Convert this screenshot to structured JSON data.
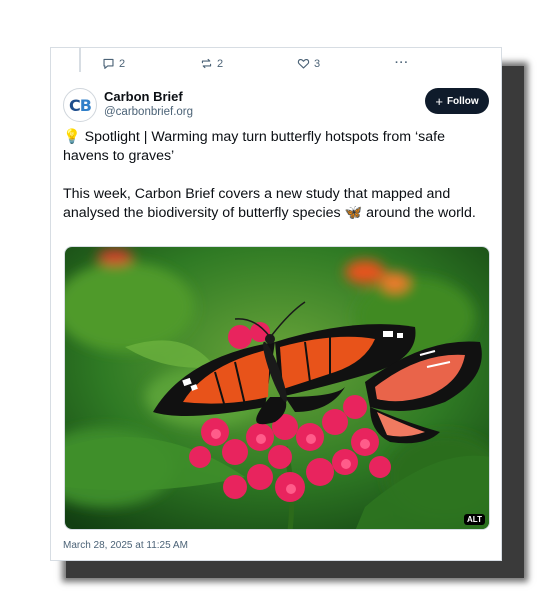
{
  "actions": {
    "replies": "2",
    "reposts": "2",
    "likes": "3",
    "more": "···"
  },
  "author": {
    "avatar_letters": "CB",
    "name": "Carbon Brief",
    "handle": "@carbonbrief.org"
  },
  "follow_button": {
    "icon": "+",
    "label": "Follow"
  },
  "post": {
    "line1_emoji": "💡",
    "line1_text": "Spotlight | Warming may turn butterfly hotspots from ‘safe havens to graves’",
    "para2_before": "This week, Carbon Brief covers a new study that mapped and analysed the biodiversity of butterfly species ",
    "para2_emoji": "🦋",
    "para2_after": " around the world."
  },
  "media": {
    "alt_badge": "ALT",
    "icons": [
      "butterfly-photo"
    ]
  },
  "timestamp": "March 28, 2025 at 11:25 AM",
  "colors": {
    "follow_bg": "#0f1b2b",
    "meta_text": "#4c6377",
    "butterfly_orange": "#e8531a",
    "flower_pink": "#e8245e"
  }
}
